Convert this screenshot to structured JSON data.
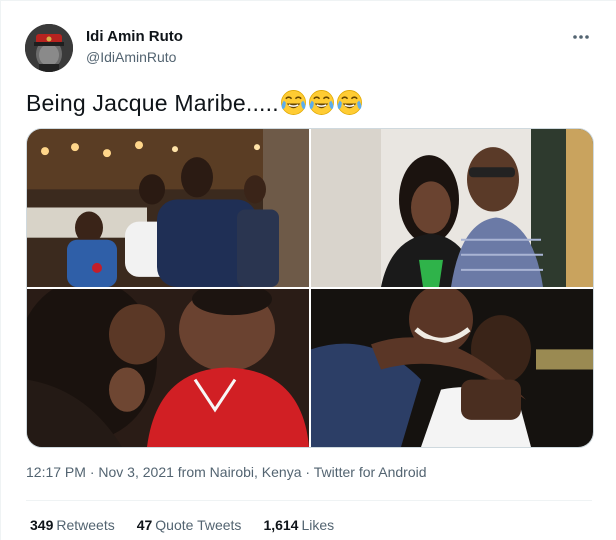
{
  "author": {
    "display_name": "Idi Amin Ruto",
    "handle": "@IdiAminRuto"
  },
  "tweet": {
    "text": "Being Jacque Maribe.....",
    "emojis": [
      "face-with-tears-of-joy",
      "face-with-tears-of-joy",
      "face-with-tears-of-joy"
    ]
  },
  "media": {
    "photos": [
      "photo-1",
      "photo-2",
      "photo-3",
      "photo-4"
    ]
  },
  "meta": {
    "time": "12:17 PM",
    "separator": "·",
    "date_location": "Nov 3, 2021 from Nairobi, Kenya",
    "client": "Twitter for Android"
  },
  "stats": {
    "retweets_count": "349",
    "retweets_label": "Retweets",
    "quotes_count": "47",
    "quotes_label": "Quote Tweets",
    "likes_count": "1,614",
    "likes_label": "Likes"
  },
  "colors": {
    "text_primary": "#0f1419",
    "text_secondary": "#536471",
    "border": "#cfd9de"
  }
}
